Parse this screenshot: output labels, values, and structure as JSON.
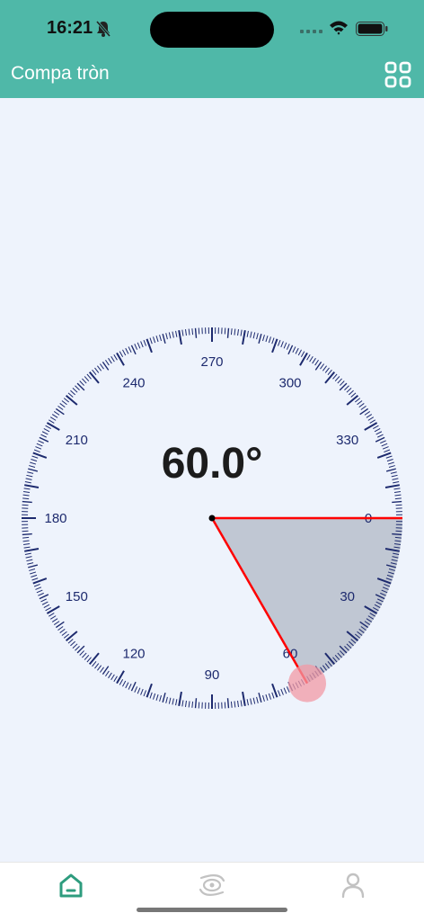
{
  "status_bar": {
    "time": "16:21",
    "icons": [
      "bell-slash-icon",
      "signal-icon",
      "wifi-icon",
      "battery-icon"
    ]
  },
  "app_bar": {
    "title": "Compa tròn",
    "menu_icon": "grid-icon",
    "background": "#4fb8a8"
  },
  "protractor": {
    "angle_display": "60.0°",
    "angle_value": 60.0,
    "scale_labels": [
      "0",
      "30",
      "60",
      "90",
      "120",
      "150",
      "180",
      "210",
      "240",
      "270",
      "300",
      "330"
    ],
    "tick_color": "#1d2a6e",
    "arm_color": "#ff0000",
    "sector_color": "#9aa3b1",
    "handle_color": "#f29aa6"
  },
  "bottom_nav": {
    "items": [
      {
        "icon": "home-icon",
        "active": true
      },
      {
        "icon": "orbit-eye-icon",
        "active": false
      },
      {
        "icon": "user-icon",
        "active": false
      }
    ],
    "active_color": "#2e9c7e",
    "inactive_color": "#c2c2c2"
  }
}
